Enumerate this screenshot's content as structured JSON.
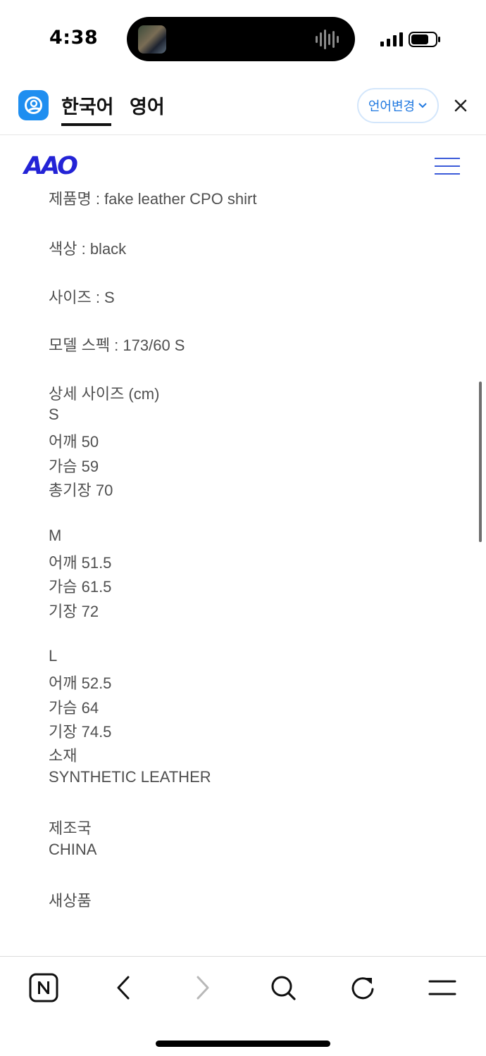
{
  "status_bar": {
    "time": "4:38"
  },
  "translator": {
    "tabs": [
      {
        "label": "한국어",
        "active": true
      },
      {
        "label": "영어",
        "active": false
      }
    ],
    "change_language_label": "언어변경",
    "icons": {
      "app": "papago-icon",
      "close": "close-icon",
      "dropdown": "chevron-down-icon"
    }
  },
  "site": {
    "logo_text": "AAO",
    "brand_color": "#2323d6",
    "menu_icon": "hamburger-menu-icon"
  },
  "product_detail": {
    "clipped_top_line": "제품명 : fake leather CPO shirt",
    "lines": [
      "색상 : black",
      "",
      "사이즈 : S",
      "",
      "모델 스펙 : 173/60 S",
      "",
      "상세 사이즈 (cm)",
      "S",
      "어깨 50",
      "가슴 59",
      "총기장 70",
      "",
      "M",
      "어깨 51.5",
      "가슴 61.5",
      "기장 72",
      "",
      "L",
      "어깨 52.5",
      "가슴 64",
      "기장 74.5",
      "소재",
      "SYNTHETIC LEATHER",
      "",
      "제조국",
      "CHINA",
      "",
      "새상품"
    ]
  },
  "toolbar": {
    "items": [
      {
        "icon": "naver-home-icon",
        "enabled": true
      },
      {
        "icon": "back-icon",
        "enabled": true
      },
      {
        "icon": "forward-icon",
        "enabled": false
      },
      {
        "icon": "search-icon",
        "enabled": true
      },
      {
        "icon": "refresh-icon",
        "enabled": true
      },
      {
        "icon": "menu-icon",
        "enabled": true
      }
    ]
  }
}
